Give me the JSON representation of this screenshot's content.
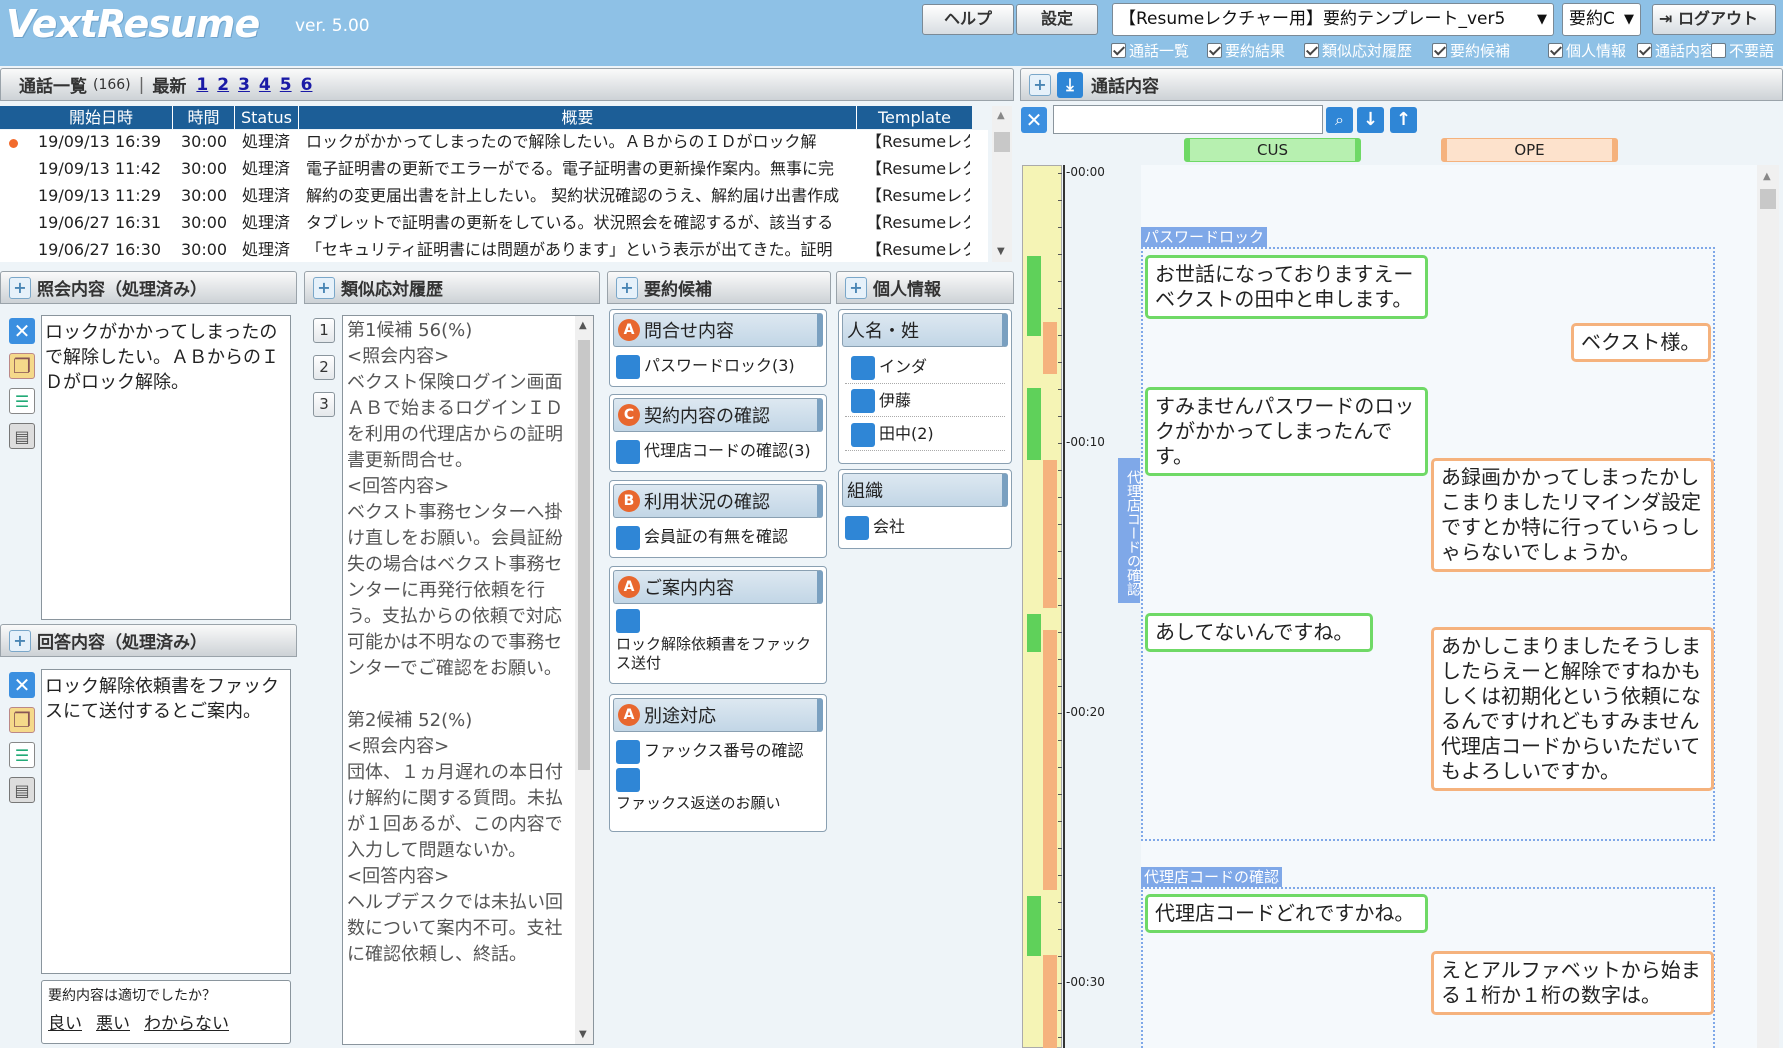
{
  "app": {
    "logo": "VextResume",
    "version": "ver. 5.00"
  },
  "toolbar": {
    "help": "ヘルプ",
    "settings": "設定",
    "template": "【Resumeレクチャー用】要約テンプレート_ver5",
    "summary_mode": "要約C",
    "logout": "ログアウト"
  },
  "filters": [
    {
      "label": "通話一覧",
      "checked": true
    },
    {
      "label": "要約結果",
      "checked": true
    },
    {
      "label": "類似応対履歴",
      "checked": true
    },
    {
      "label": "要約候補",
      "checked": true
    },
    {
      "label": "個人情報",
      "checked": true
    },
    {
      "label": "通話内容",
      "checked": true
    },
    {
      "label": "不要語",
      "checked": false
    }
  ],
  "calls": {
    "title": "通話一覧",
    "count": "(166)",
    "latest_label": "最新",
    "pages": [
      "1",
      "2",
      "3",
      "4",
      "5",
      "6"
    ],
    "columns": [
      "開始日時",
      "時間",
      "Status",
      "概要",
      "Template"
    ],
    "rows": [
      {
        "date": "19/09/13 16:39",
        "dur": "30:00",
        "status": "処理済",
        "summary": "ロックがかかってしまったので解除したい。ＡＢからのＩＤがロック解",
        "tpl": "【Resumeレク",
        "active": true
      },
      {
        "date": "19/09/13 11:42",
        "dur": "30:00",
        "status": "処理済",
        "summary": "電子証明書の更新でエラーがでる。電子証明書の更新操作案内。無事に完",
        "tpl": "【Resumeレク",
        "active": false
      },
      {
        "date": "19/09/13 11:29",
        "dur": "30:00",
        "status": "処理済",
        "summary": "解約の変更届出書を計上したい。 契約状況確認のうえ、解約届け出書作成",
        "tpl": "【Resumeレク",
        "active": false
      },
      {
        "date": "19/06/27 16:31",
        "dur": "30:00",
        "status": "処理済",
        "summary": "タブレットで証明書の更新をしている。状況照会を確認するが、該当する",
        "tpl": "【Resumeレク",
        "active": false
      },
      {
        "date": "19/06/27 16:30",
        "dur": "30:00",
        "status": "処理済",
        "summary": "「セキュリティ証明書には問題があります」という表示が出てきた。証明",
        "tpl": "【Resumeレク",
        "active": false
      }
    ]
  },
  "inquiry": {
    "title": "照会内容（処理済み）",
    "text": "ロックがかかってしまったので解除したい。ＡＢからのＩＤがロック解除。"
  },
  "answer": {
    "title": "回答内容（処理済み）",
    "text": "ロック解除依頼書をファックスにて送付するとご案内。"
  },
  "feedback": {
    "question": "要約内容は適切でしたか？",
    "good": "良い",
    "bad": "悪い",
    "unknown": "わからない"
  },
  "similar": {
    "title": "類似応対履歴",
    "nums": [
      "1",
      "2",
      "3"
    ],
    "lines": [
      "第1候補 56(%)",
      "<照会内容>",
      "ベクスト保険ログイン画面ＡＢで始まるログインＩＤを利用の代理店からの証明書更新問合せ。",
      "<回答内容>",
      "ベクスト事務センターへ掛け直しをお願い。会員証紛失の場合はベクスト事務センターに再発行依頼を行う。支払からの依頼で対応可能かは不明なので事務センターでご確認をお願い。",
      "",
      "第2候補 52(%)",
      "<照会内容>",
      "団体、１ヵ月遅れの本日付け解約に関する質問。未払が１回あるが、この内容で入力して問題ないか。",
      "<回答内容>",
      "ヘルプデスクでは未払い回数について案内不可。支社に確認依頼し、終話。"
    ]
  },
  "candidates": {
    "title": "要約候補",
    "groups": [
      {
        "badge": "A",
        "label": "問合せ内容",
        "items": [
          "パスワードロック(3)"
        ]
      },
      {
        "badge": "C",
        "label": "契約内容の確認",
        "items": [
          "代理店コードの確認(3)"
        ]
      },
      {
        "badge": "B",
        "label": "利用状況の確認",
        "items": [
          "会員証の有無を確認"
        ]
      },
      {
        "badge": "A",
        "label": "ご案内内容",
        "items": [
          "",
          "ロック解除依頼書をファックス送付"
        ]
      },
      {
        "badge": "A",
        "label": "別途対応",
        "items": [
          "ファックス番号の確認",
          "",
          "ファックス返送のお願い"
        ]
      }
    ]
  },
  "personal": {
    "title": "個人情報",
    "name_group": {
      "label": "人名・姓",
      "items": [
        "インダ",
        "伊藤",
        "田中(2)"
      ]
    },
    "org_group": {
      "label": "組織",
      "items": [
        "会社"
      ]
    }
  },
  "transcript": {
    "title": "通話内容",
    "search_placeholder": "",
    "cus_label": "CUS",
    "ope_label": "OPE",
    "times": [
      "-00:00",
      "-00:10",
      "-00:20",
      "-00:30"
    ],
    "segments": [
      "パスワードロック",
      "代理店コードの確認",
      "代理店コードの確認"
    ],
    "messages": [
      {
        "speaker": "cus",
        "text": "お世話になっておりますえーベクストの田中と申します。"
      },
      {
        "speaker": "ope",
        "text": "ベクスト様。"
      },
      {
        "speaker": "cus",
        "text": "すみませんパスワードのロックがかかってしまったんです。"
      },
      {
        "speaker": "ope",
        "text": "あ録画かかってしまったかしこまりましたリマインダ設定ですとか特に行っていらっしゃらないでしょうか。"
      },
      {
        "speaker": "cus",
        "text": "あしてないんですね。"
      },
      {
        "speaker": "ope",
        "text": "あかしこまりましたそうしましたらえーと解除ですねかもしくは初期化という依頼になるんですけれどもすみません代理店コードからいただいてもよろしいですか。"
      },
      {
        "speaker": "cus",
        "text": "代理店コードどれですかね。"
      },
      {
        "speaker": "ope",
        "text": "えとアルファベットから始まる１桁か１桁の数字は。"
      }
    ]
  },
  "colors": {
    "topbar": "#8ec1e6",
    "table_header": "#1c5e97",
    "cus": "#6fd966",
    "ope": "#f5b27d",
    "segment": "#7fa8e8",
    "badge": "#e8672e"
  }
}
